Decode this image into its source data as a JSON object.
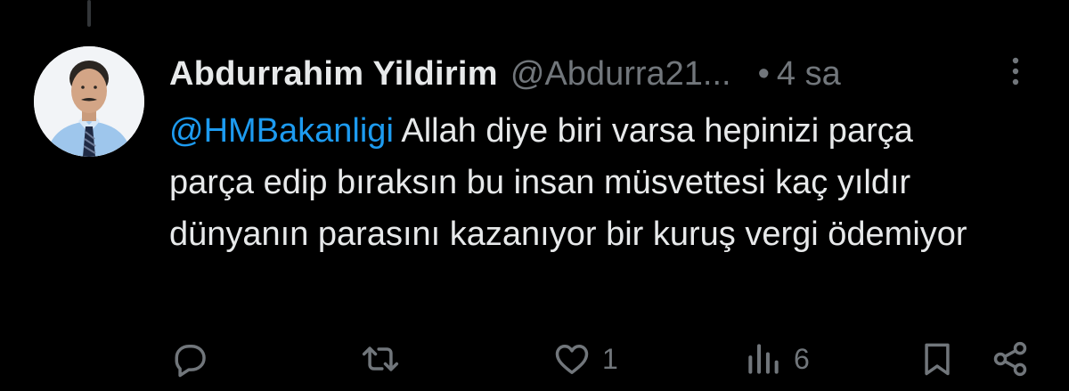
{
  "tweet": {
    "author": {
      "display_name": "Abdurrahim Yildirim",
      "handle": "@Abdurra21...",
      "avatar_icon": "profile-photo"
    },
    "separator": "•",
    "time": "4 sa",
    "text": {
      "mention": "@HMBakanligi",
      "body": " Allah diye biri varsa hepinizi parça parça edip bıraksın bu insan müsvettesi kaç yıldır dünyanın parasını kazanıyor bir kuruş vergi ödemiyor"
    }
  },
  "actions": {
    "reply": {
      "icon": "reply-icon",
      "count": ""
    },
    "retweet": {
      "icon": "retweet-icon",
      "count": ""
    },
    "like": {
      "icon": "heart-icon",
      "count": "1"
    },
    "views": {
      "icon": "views-icon",
      "count": "6"
    },
    "bookmark": {
      "icon": "bookmark-icon"
    },
    "share": {
      "icon": "share-icon"
    }
  },
  "colors": {
    "background": "#000000",
    "primary_text": "#e7e9ea",
    "secondary_text": "#71767b",
    "mention": "#1d9bf0"
  }
}
